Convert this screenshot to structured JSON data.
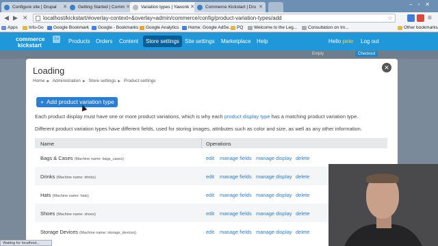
{
  "browser": {
    "tabs": [
      {
        "title": "Configure site | Drupal"
      },
      {
        "title": "Getting Started | Comm"
      },
      {
        "title": "Variation types | Yawonk"
      },
      {
        "title": "Commerce Kickstart | Dru"
      }
    ],
    "url": "localhost/kickstart/#overlay-context=&overlay=admin/commerce/config/product-variation-types/add",
    "bookmarks": [
      "Apps",
      "Info-Go",
      "Google Bookmark",
      "Google - Bookmarks",
      "Google Analytics",
      "Home: Google AdSe...",
      "PQ",
      "Welcome to the Leg...",
      "Consultation on Im..."
    ],
    "other_bookmarks": "Other bookmarks",
    "status": "Waiting for localhost..."
  },
  "site": {
    "logo_line1": "commerce",
    "logo_line2": "kickstart",
    "logo_badge": "2.x",
    "nav": [
      "Products",
      "Orders",
      "Content",
      "Store settings",
      "Site settings",
      "Marketplace",
      "Help"
    ],
    "hello_prefix": "Hello ",
    "user": "pete",
    "logout": "Log out",
    "strip_left": "Empty",
    "strip_btn": "Checkout"
  },
  "dialog": {
    "title": "Loading",
    "breadcrumb": [
      "Home",
      "Administration",
      "Store settings",
      "Product settings"
    ],
    "add_button": "Add product variation type",
    "para1_pre": "Each product display must have one or more product variations, which is why each ",
    "para1_link": "product display type",
    "para1_post": " has a matching product variation type.",
    "para2": "Different product variation types have different fields, used for storing images, attributes such as color and size, as well as any other information.",
    "table": {
      "headers": [
        "Name",
        "Operations"
      ],
      "rows": [
        {
          "name": "Bags & Cases",
          "machine": "(Machine name: bags_cases)"
        },
        {
          "name": "Drinks",
          "machine": "(Machine name: drinks)"
        },
        {
          "name": "Hats",
          "machine": "(Machine name: hats)"
        },
        {
          "name": "Shoes",
          "machine": "(Machine name: shoes)"
        },
        {
          "name": "Storage Devices",
          "machine": "(Machine name: storage_devices)"
        }
      ],
      "ops": [
        "edit",
        "manage fields",
        "manage display",
        "delete"
      ]
    }
  },
  "colors": {
    "header": "#1f97d9",
    "active_nav": "#0b5f98",
    "button": "#2a7fd0",
    "link": "#2d7bc7"
  }
}
